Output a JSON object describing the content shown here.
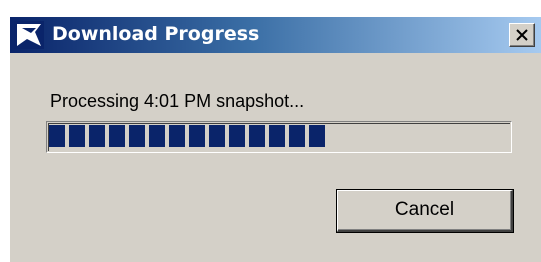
{
  "window": {
    "title": "Download Progress",
    "icon": "kite-icon",
    "close_icon": "close-icon"
  },
  "dialog": {
    "message": "Processing 4:01 PM  snapshot...",
    "progress": {
      "filled_blocks": 14,
      "fraction": 0.6,
      "color": "#0a246a"
    },
    "cancel_label": "Cancel"
  }
}
